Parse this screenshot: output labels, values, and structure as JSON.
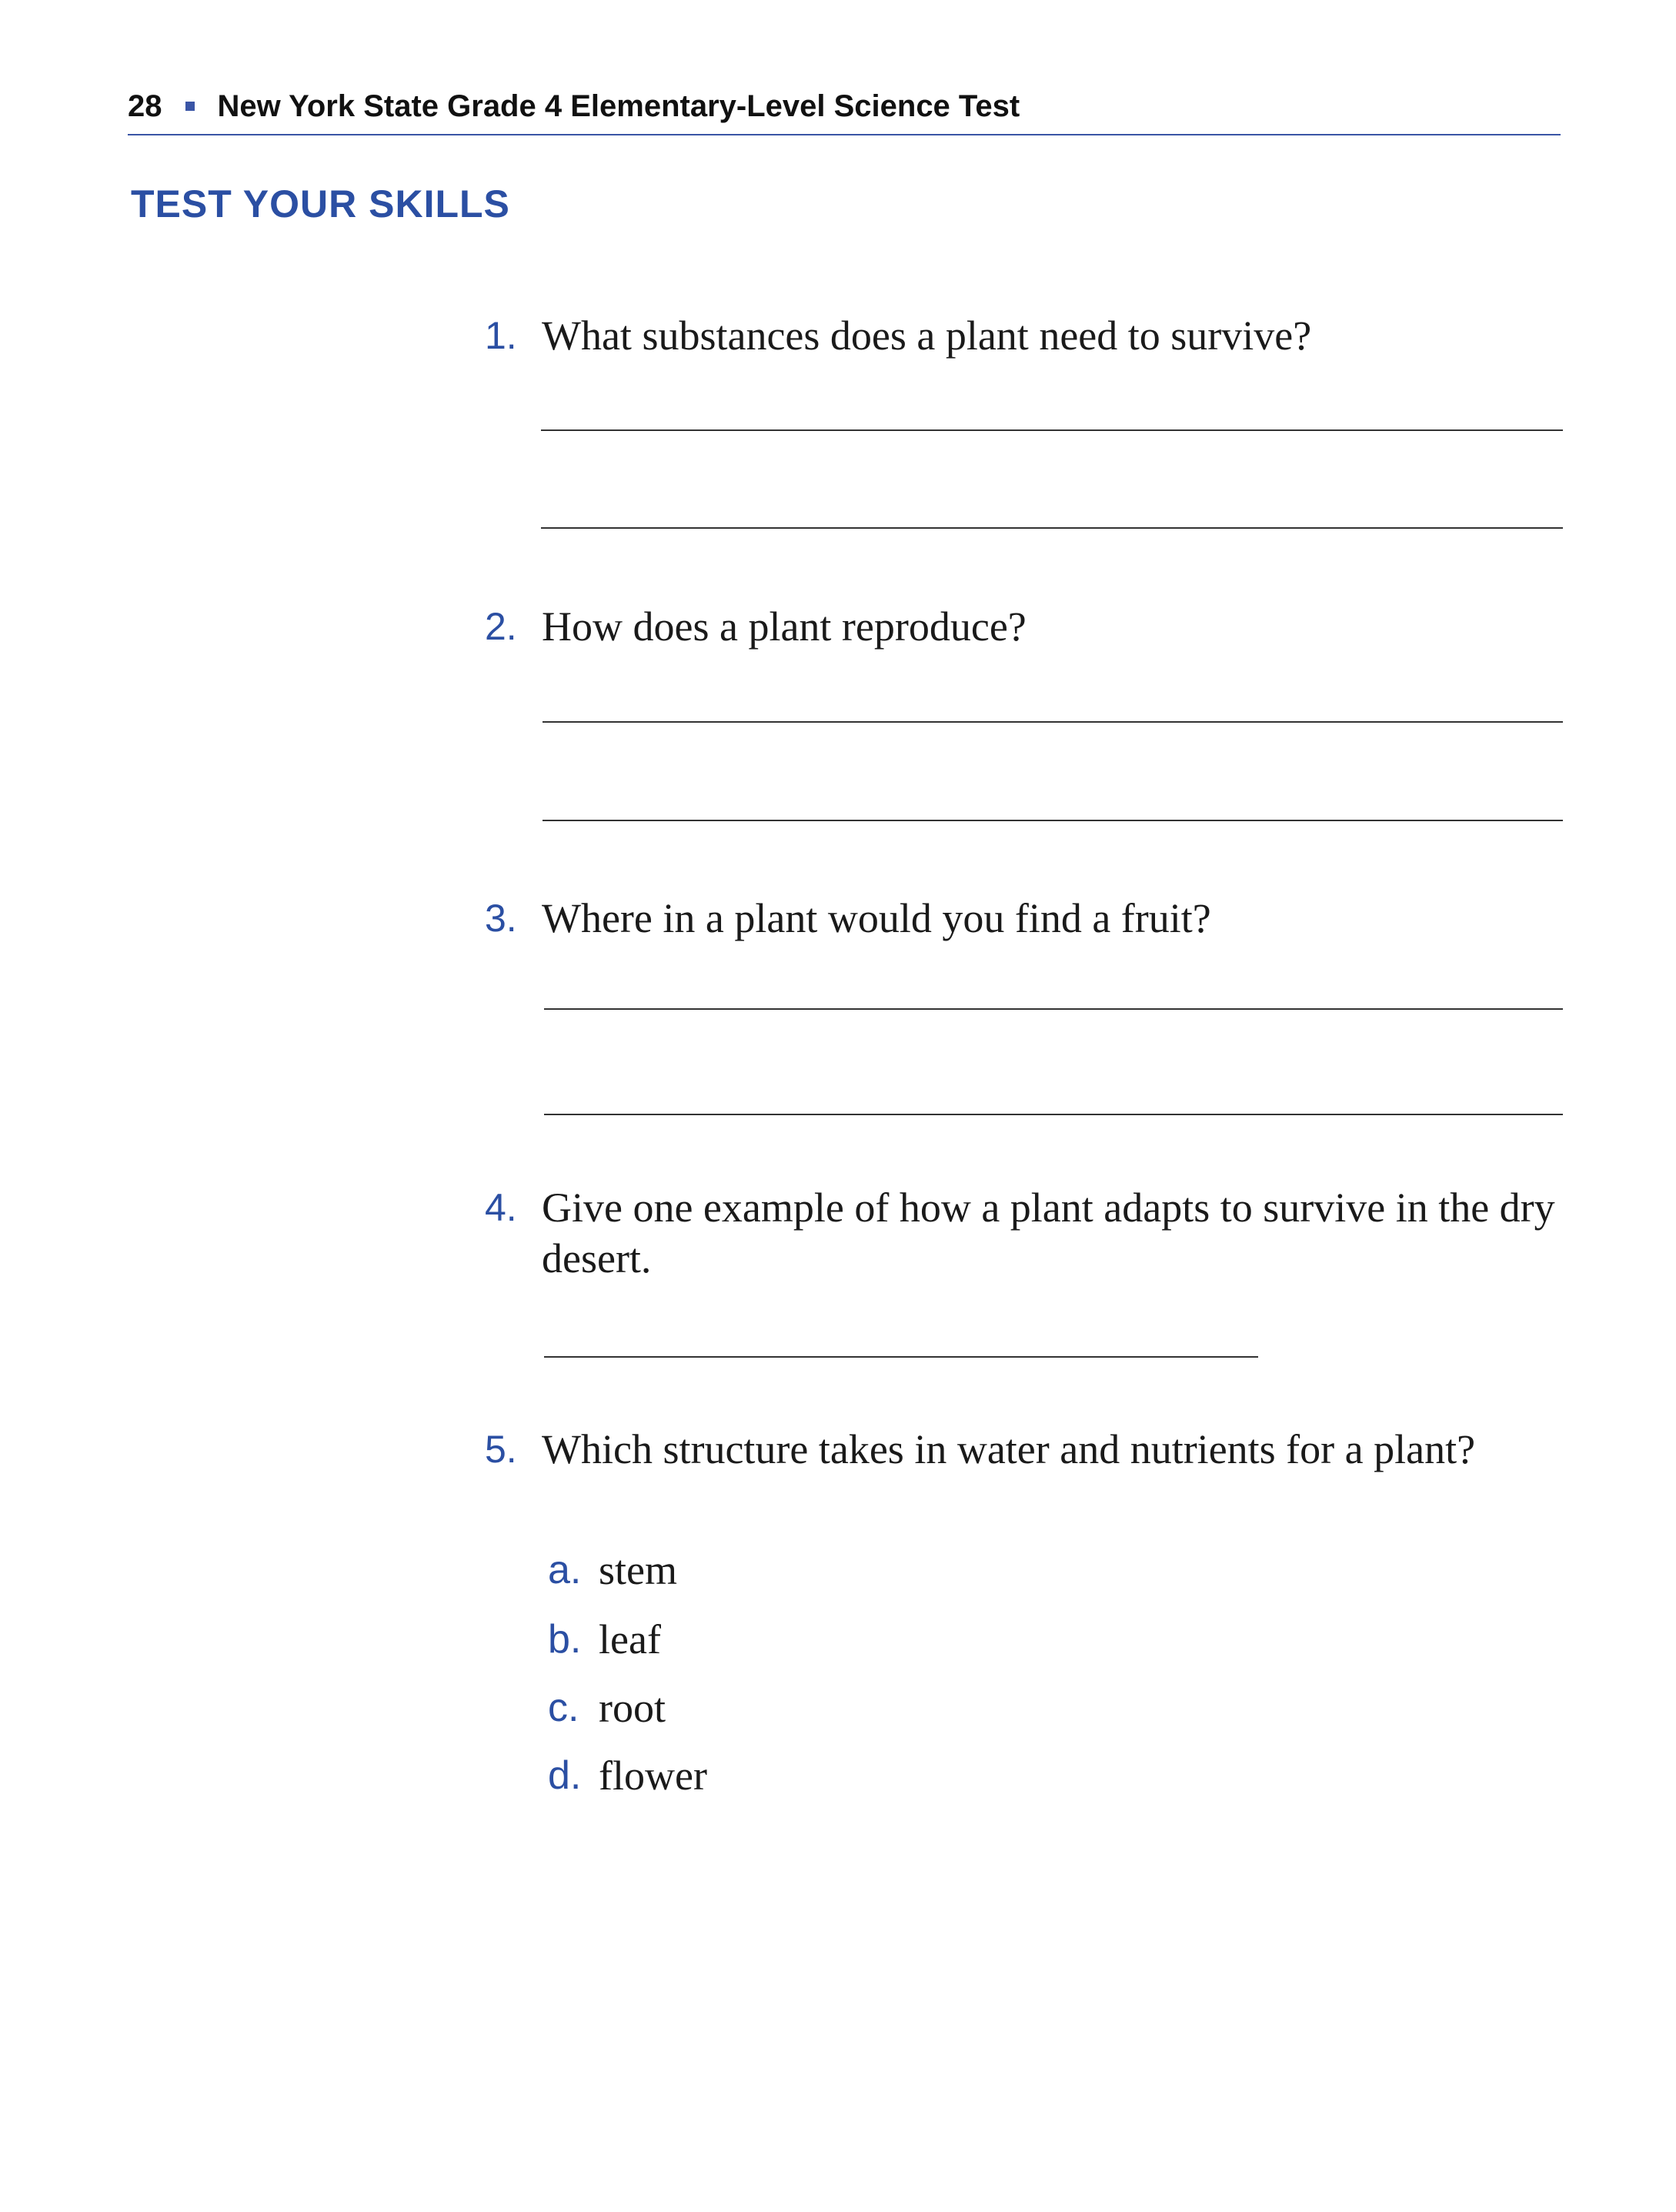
{
  "header": {
    "page_number": "28",
    "title": "New York State Grade 4 Elementary-Level Science Test"
  },
  "section_title": "TEST YOUR SKILLS",
  "questions": [
    {
      "number": "1.",
      "text": "What substances does a plant need to survive?"
    },
    {
      "number": "2.",
      "text": "How does a plant reproduce?"
    },
    {
      "number": "3.",
      "text": "Where in a plant would you find a fruit?"
    },
    {
      "number": "4.",
      "text": "Give one example of how a plant adapts to survive in the dry desert."
    },
    {
      "number": "5.",
      "text": "Which structure takes in water and nutrients for a plant?"
    }
  ],
  "choices": [
    {
      "letter": "a.",
      "text": "stem"
    },
    {
      "letter": "b.",
      "text": "leaf"
    },
    {
      "letter": "c.",
      "text": "root"
    },
    {
      "letter": "d.",
      "text": "flower"
    }
  ],
  "colors": {
    "accent": "#2b4fa3",
    "rule": "#3a55a6"
  }
}
